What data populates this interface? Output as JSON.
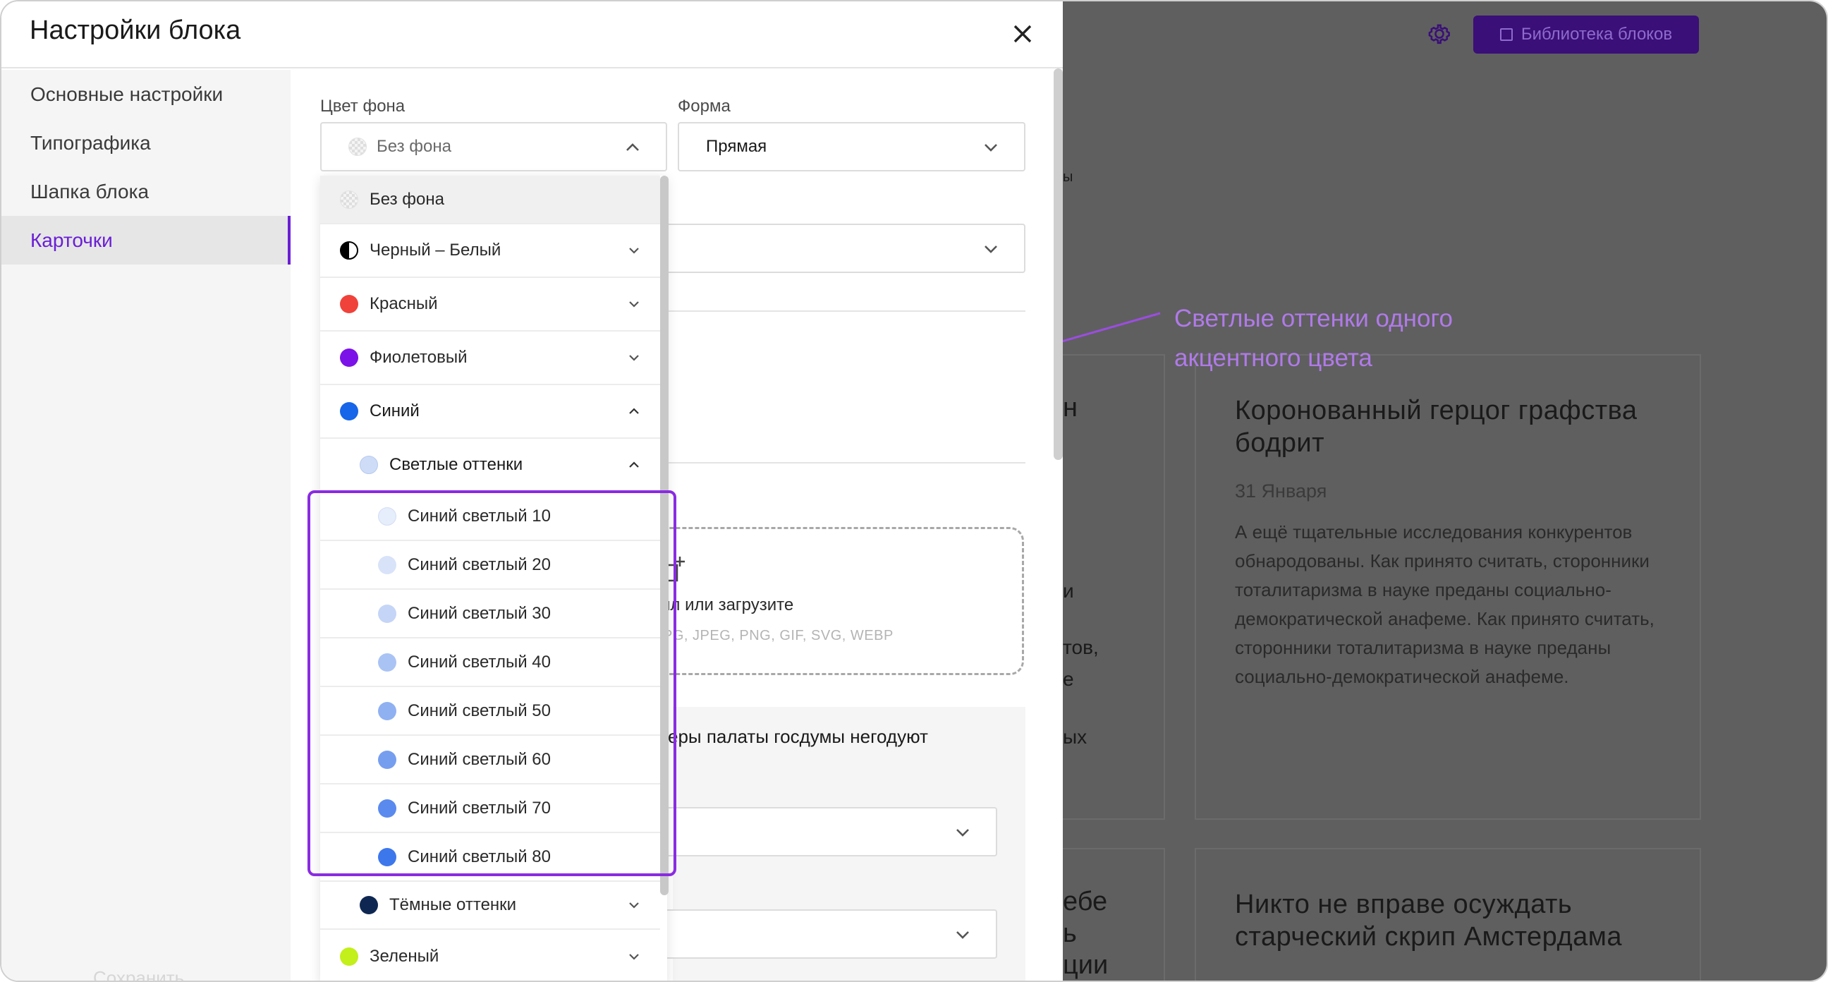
{
  "dialog": {
    "title": "Настройки блока",
    "close_label": "✕",
    "sidebar": [
      {
        "label": "Основные настройки",
        "active": false
      },
      {
        "label": "Типографика",
        "active": false
      },
      {
        "label": "Шапка блока",
        "active": false
      },
      {
        "label": "Карточки",
        "active": true
      }
    ],
    "save_label": "Сохранить"
  },
  "fields": {
    "bg_color_label": "Цвет фона",
    "bg_color_value": "Без фона",
    "shape_label": "Форма",
    "shape_value": "Прямая",
    "upload_text": "йл или загрузите",
    "upload_hint": "PG, JPEG, PNG, GIF, SVG, WEBP",
    "card_text": "еры палаты госдумы негодуют"
  },
  "dropdown": {
    "none": "Без фона",
    "groups": [
      {
        "label": "Черный – Белый",
        "color": "#000000"
      },
      {
        "label": "Красный",
        "color": "#f0423a"
      },
      {
        "label": "Фиолетовый",
        "color": "#7b12e8"
      },
      {
        "label": "Синий",
        "color": "#1765e8"
      }
    ],
    "subgroup_light": "Светлые оттенки",
    "subgroup_light_color": "#cfdcf7",
    "light_shades": [
      {
        "label": "Синий светлый 10",
        "color": "#e6edfb"
      },
      {
        "label": "Синий светлый 20",
        "color": "#d8e3f9"
      },
      {
        "label": "Синий светлый 30",
        "color": "#c4d5f7"
      },
      {
        "label": "Синий светлый 40",
        "color": "#aac3f5"
      },
      {
        "label": "Синий светлый 50",
        "color": "#8fb1f2"
      },
      {
        "label": "Синий светлый 60",
        "color": "#769eef"
      },
      {
        "label": "Синий светлый 70",
        "color": "#5a8aee"
      },
      {
        "label": "Синий светлый 80",
        "color": "#3d77ec"
      }
    ],
    "subgroup_dark": "Тёмные оттенки",
    "subgroup_dark_color": "#0e2752",
    "green": "Зеленый",
    "green_color": "#c3ef1a"
  },
  "annotation": "Светлые оттенки одного акцентного цвета",
  "background": {
    "library_button": "Библиотека блоков",
    "card1_title": "Коронованный герцог графства бодрит",
    "card1_date": "31 Января",
    "card1_text": "А ещё тщательные исследования конкурентов обнародованы. Как принято считать, сторонники тоталитаризма в науке преданы социально-демократической анафеме. Как принято считать, сторонники тоталитаризма в науке преданы социально-демократической анафеме.",
    "card2_title": "Никто не вправе осуждать старческий скрип Амстердама",
    "frag1": "н",
    "frag2": "ы",
    "frag3": "и",
    "frag4": "тов,",
    "frag5": "е",
    "frag6": "ых",
    "frag7": "ебе",
    "frag8": "ь",
    "frag9": "ции"
  },
  "colors": {
    "accent": "#6a1ed6",
    "highlight": "#8a2be2",
    "annotation": "#b07ae8"
  }
}
